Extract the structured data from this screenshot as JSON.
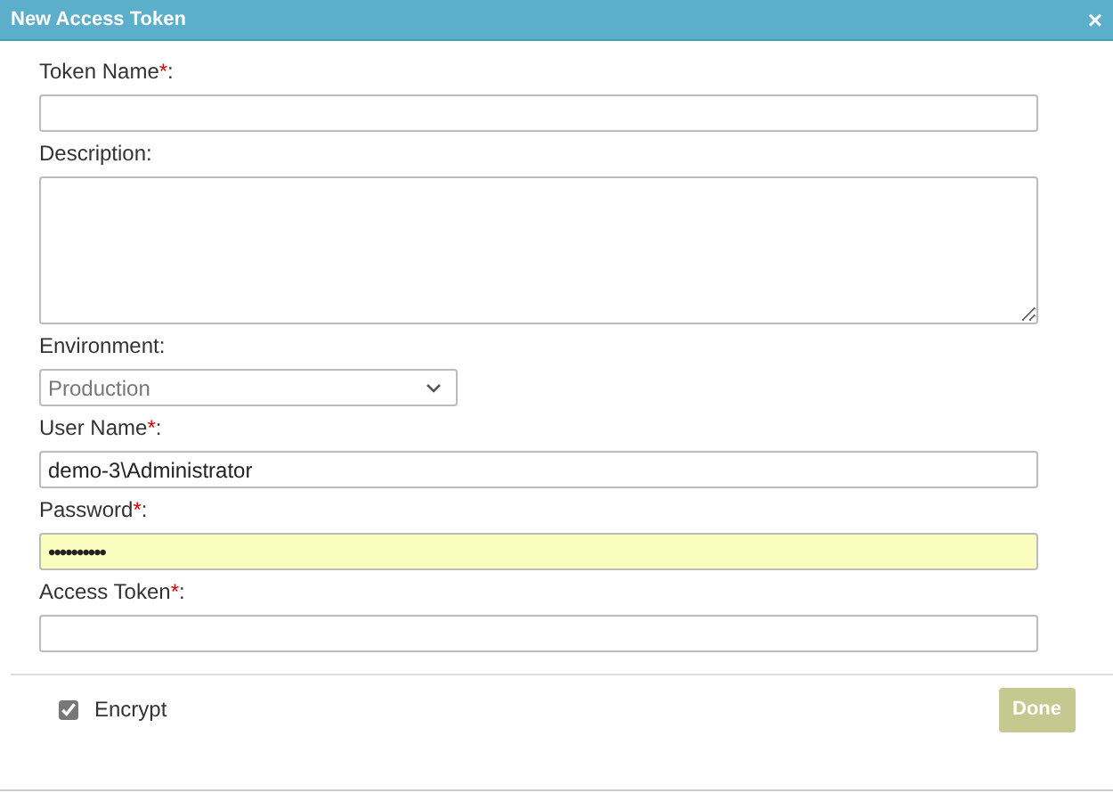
{
  "window": {
    "title": "New Access Token",
    "close": "×"
  },
  "fields": [
    {
      "kind": "text",
      "label": "Token Name",
      "required_mark": "*",
      "label_end": ":",
      "highlighted": false
    },
    {
      "kind": "textarea",
      "label": "Description:",
      "highlighted": false
    },
    {
      "kind": "select",
      "label": "Environment:",
      "value": "Production",
      "highlighted": false
    },
    {
      "kind": "text",
      "label": "User Name",
      "required_mark": "*",
      "label_end": ":",
      "value": "demo-3\\Administrator",
      "highlighted": false
    },
    {
      "kind": "password",
      "label": "Password",
      "required_mark": "*",
      "label_end": ":",
      "value": "••••••••••",
      "highlighted": true
    },
    {
      "kind": "text",
      "label": "Access Token",
      "required_mark": "*",
      "label_end": ":",
      "highlighted": false
    }
  ],
  "encrypt": {
    "label": "Encrypt",
    "checked": true
  },
  "buttons": [
    {
      "label": "Done",
      "disabled": true
    }
  ]
}
